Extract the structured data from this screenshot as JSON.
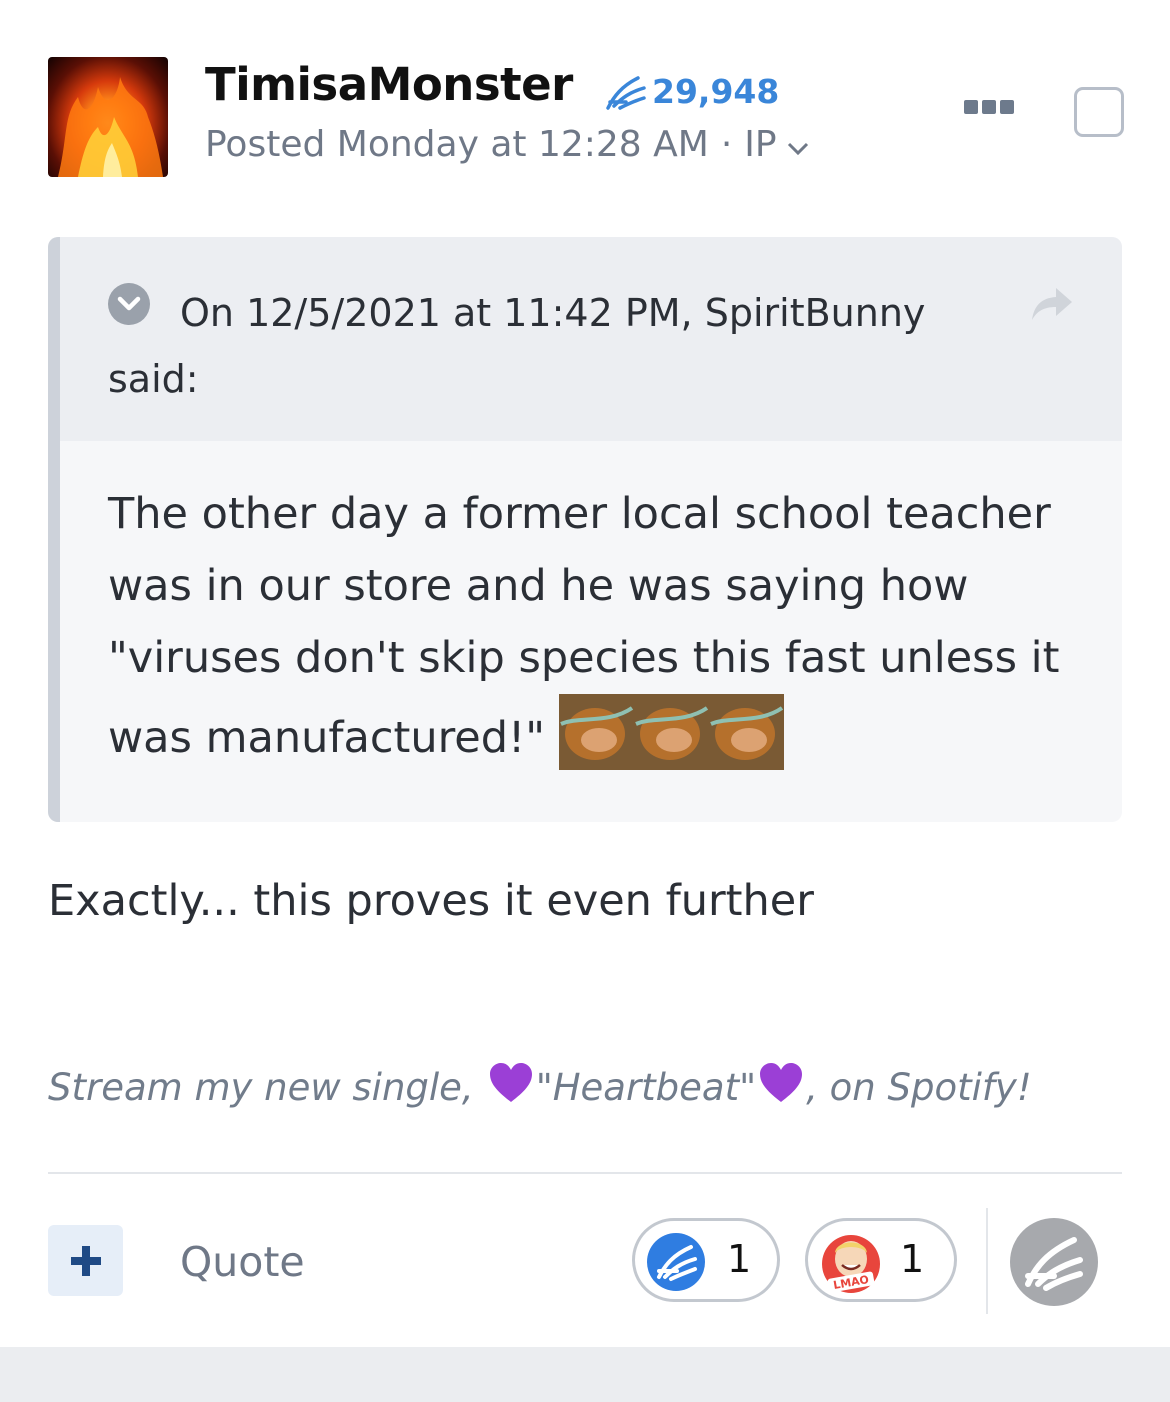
{
  "post": {
    "author": "TimisaMonster",
    "reputation": "29,948",
    "posted": "Posted Monday at 12:28 AM",
    "separator": "·",
    "ip_label": "IP",
    "body": "Exactly... this proves it even further"
  },
  "quote": {
    "citation": "On 12/5/2021 at 11:42 PM, SpiritBunny said:",
    "body": "The other day a former local school teacher was in our store and he was saying how \"viruses don't skip species this fast unless it was manufactured!\""
  },
  "signature": {
    "before": "Stream my new single,",
    "title": "\"Heartbeat\"",
    "after": ", on Spotify!"
  },
  "footer": {
    "quote_label": "Quote",
    "reactions": [
      {
        "icon": "wave-hand-icon",
        "count": "1"
      },
      {
        "icon": "lmao-icon",
        "count": "1",
        "badge": "LMAO"
      }
    ]
  },
  "colors": {
    "accent": "#3a86d9",
    "muted": "#6f7887",
    "heart": "#9b3fd6"
  }
}
